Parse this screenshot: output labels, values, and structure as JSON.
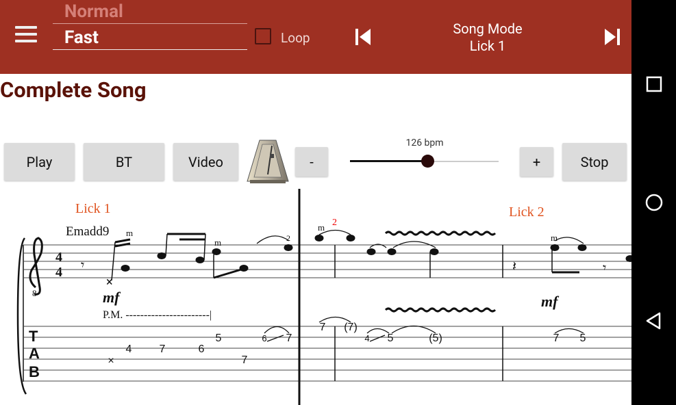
{
  "topbar": {
    "speed_prev": "Normal",
    "speed_current": "Fast",
    "loop_label": "Loop",
    "mode_line1": "Song Mode",
    "mode_line2": "Lick 1"
  },
  "page": {
    "title": "Complete Song"
  },
  "controls": {
    "play": "Play",
    "bt": "BT",
    "video": "Video",
    "minus": "-",
    "plus": "+",
    "stop": "Stop",
    "bpm_label": "126 bpm",
    "bpm_slider_fraction": 0.52
  },
  "score": {
    "lick1": "Lick 1",
    "lick2": "Lick 2",
    "chord": "Emadd9",
    "dynamic1": "mf",
    "dynamic2": "mf",
    "pm": "P.M. -----------------------|",
    "time_sig_top": "4",
    "time_sig_bottom": "4",
    "clef_8": "8",
    "finger_m1": "m",
    "finger_m2": "m",
    "finger_m3": "m",
    "finger_m4": "m",
    "fret_2a": "2",
    "fret_2b": "2",
    "tab_numbers": [
      "4",
      "7",
      "6",
      "5",
      "7",
      "6",
      "7",
      "7",
      "(7)",
      "4",
      "5",
      "(5)",
      "7",
      "5"
    ],
    "tab_label": [
      "T",
      "A",
      "B"
    ]
  },
  "colors": {
    "topbar": "#9e3022",
    "title": "#5a1208",
    "lick": "#e0531f"
  }
}
